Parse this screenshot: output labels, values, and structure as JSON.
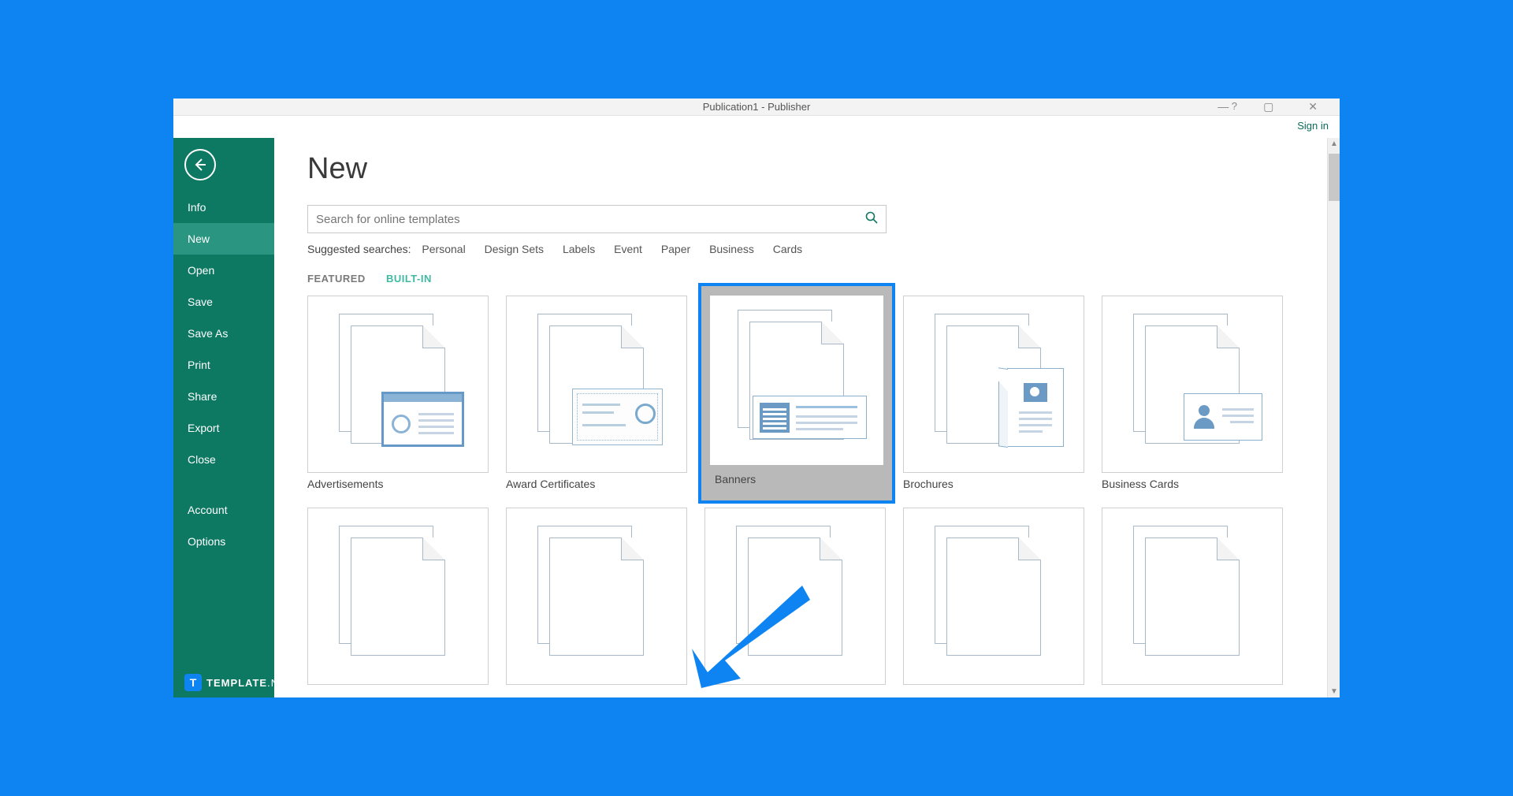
{
  "titlebar": {
    "title": "Publication1 - Publisher"
  },
  "signin": "Sign in",
  "sidebar": {
    "items": [
      {
        "label": "Info"
      },
      {
        "label": "New"
      },
      {
        "label": "Open"
      },
      {
        "label": "Save"
      },
      {
        "label": "Save As"
      },
      {
        "label": "Print"
      },
      {
        "label": "Share"
      },
      {
        "label": "Export"
      },
      {
        "label": "Close"
      },
      {
        "label": "Account"
      },
      {
        "label": "Options"
      }
    ],
    "active_index": 1
  },
  "page": {
    "title": "New"
  },
  "search": {
    "placeholder": "Search for online templates"
  },
  "suggested": {
    "label": "Suggested searches:",
    "links": [
      "Personal",
      "Design Sets",
      "Labels",
      "Event",
      "Paper",
      "Business",
      "Cards"
    ]
  },
  "tabs": [
    {
      "label": "FEATURED",
      "active": true
    },
    {
      "label": "BUILT-IN",
      "active": false
    }
  ],
  "templates_row1": [
    {
      "label": "Advertisements",
      "kind": "ad"
    },
    {
      "label": "Award Certificates",
      "kind": "cert"
    },
    {
      "label": "Banners",
      "kind": "ban",
      "selected": true
    },
    {
      "label": "Brochures",
      "kind": "bro"
    },
    {
      "label": "Business Cards",
      "kind": "bc"
    }
  ],
  "watermark": {
    "brand": "TEMPLATE",
    "suffix": ".NET"
  }
}
